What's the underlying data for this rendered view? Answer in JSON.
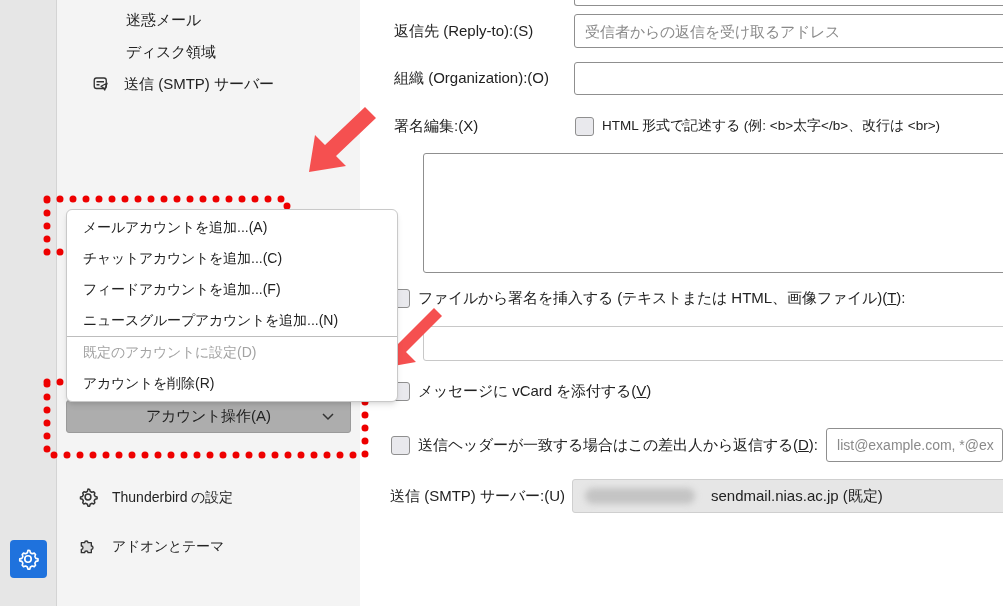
{
  "sidebar": {
    "items": [
      {
        "label": "迷惑メール",
        "kind": "plain"
      },
      {
        "label": "ディスク領域",
        "kind": "plain"
      },
      {
        "label": "送信 (SMTP) サーバー",
        "kind": "smtp"
      }
    ],
    "footer_items": [
      {
        "label": "Thunderbird の設定",
        "kind": "settings"
      },
      {
        "label": "アドオンとテーマ",
        "kind": "addons"
      }
    ],
    "settings_button": {
      "selected": true
    }
  },
  "account_menu": {
    "groups": [
      [
        {
          "label": "メールアカウントを追加...(A)",
          "disabled": false
        },
        {
          "label": "チャットアカウントを追加...(C)",
          "disabled": false
        },
        {
          "label": "フィードアカウントを追加...(F)",
          "disabled": false
        },
        {
          "label": "ニュースグループアカウントを追加...(N)",
          "disabled": false
        }
      ],
      [
        {
          "label": "既定のアカウントに設定(D)",
          "disabled": true
        },
        {
          "label": "アカウントを削除(R)",
          "disabled": false
        }
      ]
    ]
  },
  "account_actions_button": {
    "label": "アカウント操作(A)",
    "expanded": true
  },
  "form": {
    "reply_to": {
      "label": "返信先 (Reply-to):(S)",
      "placeholder": "受信者からの返信を受け取るアドレス"
    },
    "organization": {
      "label": "組織 (Organization):(O)"
    },
    "signature": {
      "label": "署名編集:(X)",
      "html_label": "HTML 形式で記述する (例: <b>太字</b>、改行は <br>)",
      "html_checked": false
    },
    "signature_file": {
      "label_before": "ファイルから署名を挿入する (テキストまたは HTML、画像ファイル)(",
      "access_key": "T",
      "label_after": "):",
      "checked": false
    },
    "vcard": {
      "label_before": "メッセージに vCard を添付する(",
      "access_key": "V",
      "label_after": ")",
      "checked": false
    },
    "reply_from_header": {
      "label_before": "送信ヘッダーが一致する場合はこの差出人から返信する(",
      "access_key": "D",
      "label_after": "):",
      "checked": false,
      "placeholder": "list@example.com, *@ex"
    },
    "smtp": {
      "label": "送信 (SMTP) サーバー:(U)",
      "value": "sendmail.nias.ac.jp (既定)"
    }
  }
}
